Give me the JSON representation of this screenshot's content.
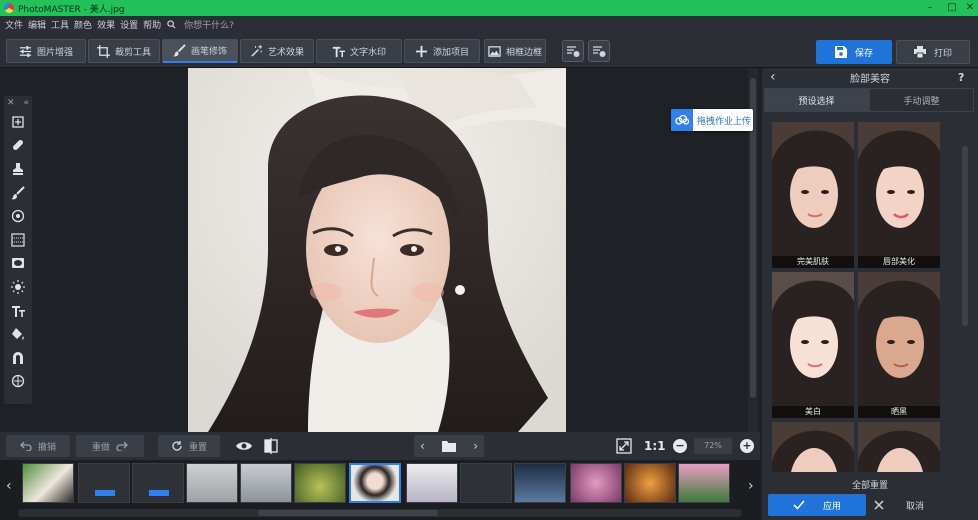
{
  "window": {
    "title": "PhotoMASTER - 美人.jpg",
    "min": "–",
    "max": "□",
    "close": "✕"
  },
  "menu": {
    "items": [
      "文件",
      "编辑",
      "工具",
      "颜色",
      "效果",
      "设置",
      "帮助"
    ],
    "search_placeholder": "你想干什么?"
  },
  "toolbar": {
    "tabs": [
      "图片增强",
      "裁剪工具",
      "画笔修饰",
      "艺术效果",
      "文字水印",
      "添加项目",
      "相框边框"
    ],
    "save_label": "保存",
    "print_label": "打印"
  },
  "cloud": {
    "label": "拖拽作业上传"
  },
  "bottom": {
    "undo": "撤销",
    "redo": "重做",
    "reset": "重置",
    "zoom_fit": "1:1",
    "zoom_value": "72%"
  },
  "panel": {
    "title": "脸部美容",
    "tabs": [
      "预设选择",
      "手动调整"
    ],
    "presets": [
      {
        "name": "完美肌肤"
      },
      {
        "name": "唇部美化"
      },
      {
        "name": "美白"
      },
      {
        "name": "晒黑"
      }
    ],
    "reset_all": "全部重置",
    "apply": "应用",
    "cancel": "取消"
  },
  "colors": {
    "accent": "#1f73d9",
    "titlebar": "#23c15a"
  }
}
